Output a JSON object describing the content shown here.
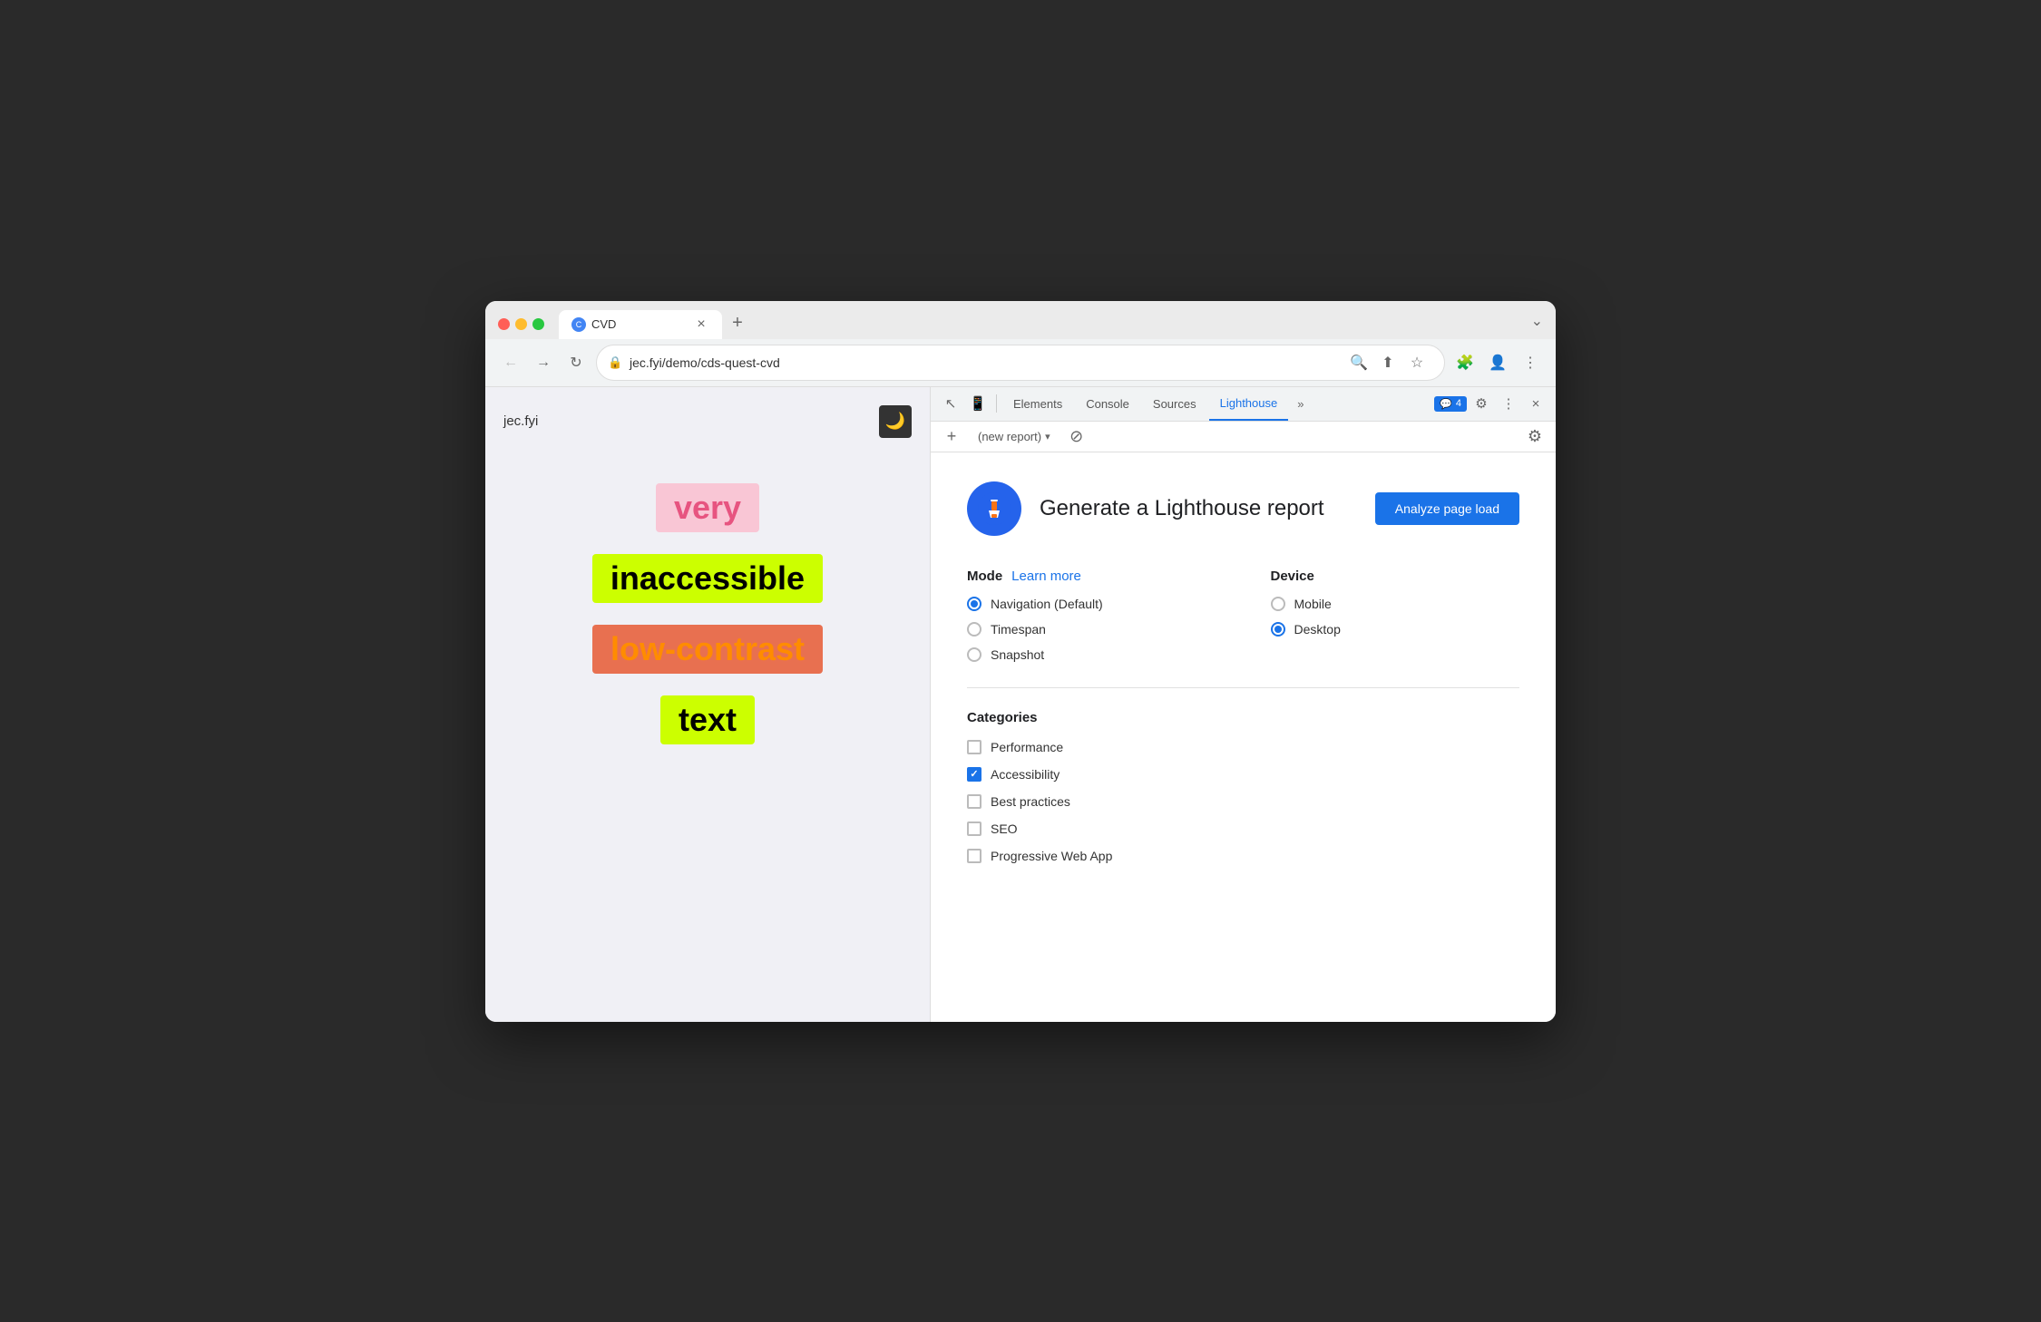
{
  "browser": {
    "tab": {
      "favicon_text": "C",
      "title": "CVD",
      "close_label": "×"
    },
    "new_tab_label": "+",
    "tab_list_chevron": "❯",
    "nav": {
      "back_label": "←",
      "forward_label": "→",
      "reload_label": "↻"
    },
    "address": {
      "lock_icon": "🔒",
      "url": "jec.fyi/demo/cds-quest-cvd"
    },
    "address_icons": {
      "search": "🔍",
      "share": "⬆",
      "bookmark": "☆",
      "extensions": "🧩",
      "profile": "👤",
      "menu": "⋮"
    }
  },
  "webpage": {
    "site_title": "jec.fyi",
    "dark_mode_icon": "🌙",
    "words": [
      {
        "text": "very",
        "class": "word-very"
      },
      {
        "text": "inaccessible",
        "class": "word-inaccessible"
      },
      {
        "text": "low-contrast",
        "class": "word-low-contrast"
      },
      {
        "text": "text",
        "class": "word-text"
      }
    ]
  },
  "devtools": {
    "tabs": [
      {
        "label": "Elements",
        "active": false
      },
      {
        "label": "Console",
        "active": false
      },
      {
        "label": "Sources",
        "active": false
      },
      {
        "label": "Lighthouse",
        "active": true
      }
    ],
    "tab_more_label": "»",
    "badge_icon": "💬",
    "badge_count": "4",
    "settings_icon": "⚙",
    "more_icon": "⋮",
    "close_icon": "×",
    "toolbar": {
      "add_icon": "+",
      "report_placeholder": "(new report)",
      "dropdown_arrow": "▾",
      "cancel_icon": "⊘",
      "settings_icon": "⚙"
    },
    "lighthouse": {
      "logo_alt": "Lighthouse logo",
      "heading": "Generate a Lighthouse report",
      "analyze_btn": "Analyze page load",
      "mode_label": "Mode",
      "learn_more_label": "Learn more",
      "device_label": "Device",
      "modes": [
        {
          "label": "Navigation (Default)",
          "selected": true
        },
        {
          "label": "Timespan",
          "selected": false
        },
        {
          "label": "Snapshot",
          "selected": false
        }
      ],
      "devices": [
        {
          "label": "Mobile",
          "selected": false
        },
        {
          "label": "Desktop",
          "selected": true
        }
      ],
      "categories_label": "Categories",
      "categories": [
        {
          "label": "Performance",
          "checked": false
        },
        {
          "label": "Accessibility",
          "checked": true
        },
        {
          "label": "Best practices",
          "checked": false
        },
        {
          "label": "SEO",
          "checked": false
        },
        {
          "label": "Progressive Web App",
          "checked": false
        }
      ]
    }
  }
}
